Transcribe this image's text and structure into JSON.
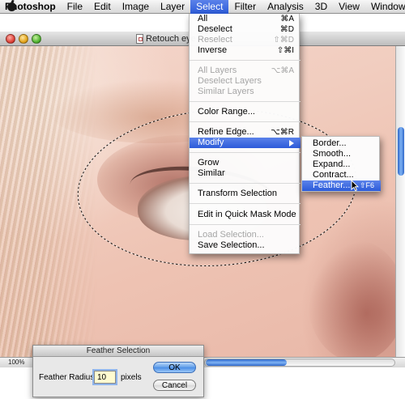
{
  "menubar": {
    "app": "Photoshop",
    "items": [
      "File",
      "Edit",
      "Image",
      "Layer",
      "Select",
      "Filter",
      "Analysis",
      "3D",
      "View",
      "Window"
    ]
  },
  "document": {
    "title": "Retouch eye",
    "zoom": "100%"
  },
  "select_menu": {
    "all": {
      "label": "All",
      "shortcut": "⌘A"
    },
    "deselect": {
      "label": "Deselect",
      "shortcut": "⌘D"
    },
    "reselect": {
      "label": "Reselect",
      "shortcut": "⇧⌘D"
    },
    "inverse": {
      "label": "Inverse",
      "shortcut": "⇧⌘I"
    },
    "all_layers": {
      "label": "All Layers",
      "shortcut": "⌥⌘A"
    },
    "deselect_layers": {
      "label": "Deselect Layers"
    },
    "similar_layers": {
      "label": "Similar Layers"
    },
    "color_range": {
      "label": "Color Range..."
    },
    "refine_edge": {
      "label": "Refine Edge...",
      "shortcut": "⌥⌘R"
    },
    "modify": {
      "label": "Modify"
    },
    "grow": {
      "label": "Grow"
    },
    "similar": {
      "label": "Similar"
    },
    "transform_selection": {
      "label": "Transform Selection"
    },
    "quick_mask": {
      "label": "Edit in Quick Mask Mode"
    },
    "load_selection": {
      "label": "Load Selection..."
    },
    "save_selection": {
      "label": "Save Selection..."
    }
  },
  "modify_submenu": {
    "border": "Border...",
    "smooth": "Smooth...",
    "expand": "Expand...",
    "contract": "Contract...",
    "feather": {
      "label": "Feather...",
      "shortcut": "⇧F6"
    }
  },
  "feather_dialog": {
    "title": "Feather Selection",
    "radius_label": "Feather Radius:",
    "radius_value": "10",
    "unit": "pixels",
    "ok": "OK",
    "cancel": "Cancel"
  },
  "colors": {
    "highlight": "#3a68dc",
    "disabled_text": "#a6a6a6",
    "skin": "#f1cdbf"
  }
}
